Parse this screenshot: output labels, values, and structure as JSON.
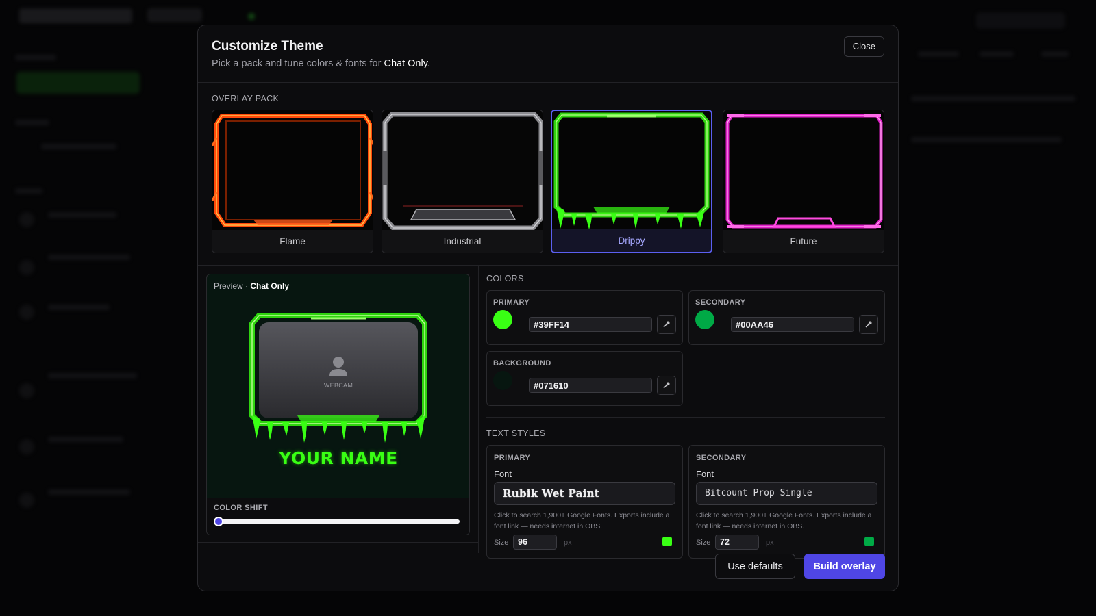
{
  "modal": {
    "title": "Customize Theme",
    "subtitle_prefix": "Pick a pack and tune colors & fonts for ",
    "subtitle_target": "Chat Only",
    "subtitle_suffix": ".",
    "close_label": "Close"
  },
  "overlay_pack": {
    "label": "OVERLAY PACK",
    "packs": [
      {
        "name": "Flame",
        "selected": false,
        "color": "#ff5a1a"
      },
      {
        "name": "Industrial",
        "selected": false,
        "color": "#9a9a9e"
      },
      {
        "name": "Drippy",
        "selected": true,
        "color": "#39ff14"
      },
      {
        "name": "Future",
        "selected": false,
        "color": "#ff2bd6"
      }
    ]
  },
  "preview": {
    "label": "Preview · ",
    "target": "Chat Only",
    "webcam_label": "WEBCAM",
    "name_text": "YOUR NAME",
    "color_shift_label": "COLOR SHIFT",
    "color_shift_value": 0
  },
  "colors": {
    "label": "COLORS",
    "primary": {
      "label": "PRIMARY",
      "hex": "#39FF14"
    },
    "secondary": {
      "label": "SECONDARY",
      "hex": "#00AA46"
    },
    "background": {
      "label": "BACKGROUND",
      "hex": "#071610"
    }
  },
  "text_styles": {
    "label": "TEXT STYLES",
    "primary": {
      "label": "PRIMARY",
      "font_label": "Font",
      "font": "Rubik Wet Paint",
      "hint": "Click to search 1,900+ Google Fonts. Exports include a font link — needs internet in OBS.",
      "size_label": "Size",
      "size": "96",
      "unit": "px",
      "color": "#39FF14"
    },
    "secondary": {
      "label": "SECONDARY",
      "font_label": "Font",
      "font": "Bitcount Prop Single",
      "hint": "Click to search 1,900+ Google Fonts. Exports include a font link — needs internet in OBS.",
      "size_label": "Size",
      "size": "72",
      "unit": "px",
      "color": "#00AA46"
    }
  },
  "footer": {
    "defaults_label": "Use defaults",
    "build_label": "Build overlay"
  }
}
